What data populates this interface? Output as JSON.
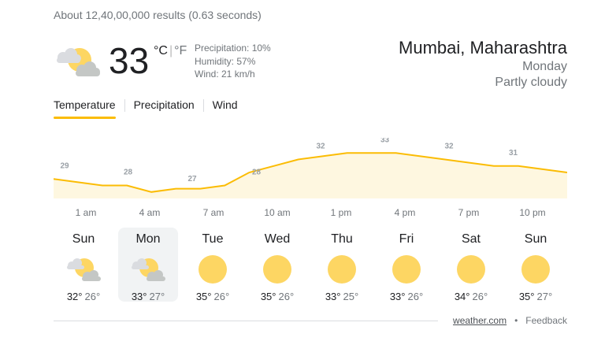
{
  "results_text": "About 12,40,00,000 results (0.63 seconds)",
  "current": {
    "icon": "partly-cloudy-icon",
    "temperature": "33",
    "unit_c": "°C",
    "unit_sep": "|",
    "unit_f": "°F",
    "precipitation": "Precipitation: 10%",
    "humidity": "Humidity: 57%",
    "wind": "Wind: 21 km/h"
  },
  "location": {
    "city": "Mumbai, Maharashtra",
    "day": "Monday",
    "condition": "Partly cloudy"
  },
  "tabs": [
    {
      "label": "Temperature",
      "active": true
    },
    {
      "label": "Precipitation",
      "active": false
    },
    {
      "label": "Wind",
      "active": false
    }
  ],
  "chart_data": {
    "type": "area",
    "x": [
      "1 am",
      "4 am",
      "7 am",
      "10 am",
      "1 pm",
      "4 pm",
      "7 pm",
      "10 pm"
    ],
    "values": [
      29,
      28,
      27,
      28,
      32,
      33,
      32,
      31
    ],
    "labels": [
      "29",
      "28",
      "27",
      "28",
      "32",
      "33",
      "32",
      "31"
    ],
    "hourly_curve": [
      29,
      28.5,
      28,
      28,
      27,
      27.5,
      27.5,
      28,
      30,
      31,
      32,
      32.5,
      33,
      33,
      33,
      32.5,
      32,
      31.5,
      31,
      31,
      30.5,
      30
    ],
    "line_color": "#fbbc04",
    "fill_color": "#fef7e0"
  },
  "forecast": [
    {
      "day": "Sun",
      "icon": "partly-cloudy-icon",
      "high": "32°",
      "low": "26°",
      "selected": false
    },
    {
      "day": "Mon",
      "icon": "partly-cloudy-icon",
      "high": "33°",
      "low": "27°",
      "selected": true
    },
    {
      "day": "Tue",
      "icon": "sun-icon",
      "high": "35°",
      "low": "26°",
      "selected": false
    },
    {
      "day": "Wed",
      "icon": "sun-icon",
      "high": "35°",
      "low": "26°",
      "selected": false
    },
    {
      "day": "Thu",
      "icon": "sun-icon",
      "high": "33°",
      "low": "25°",
      "selected": false
    },
    {
      "day": "Fri",
      "icon": "sun-icon",
      "high": "33°",
      "low": "26°",
      "selected": false
    },
    {
      "day": "Sat",
      "icon": "sun-icon",
      "high": "34°",
      "low": "26°",
      "selected": false
    },
    {
      "day": "Sun",
      "icon": "sun-icon",
      "high": "35°",
      "low": "27°",
      "selected": false
    }
  ],
  "footer": {
    "source": "weather.com",
    "separator": "•",
    "feedback": "Feedback"
  }
}
